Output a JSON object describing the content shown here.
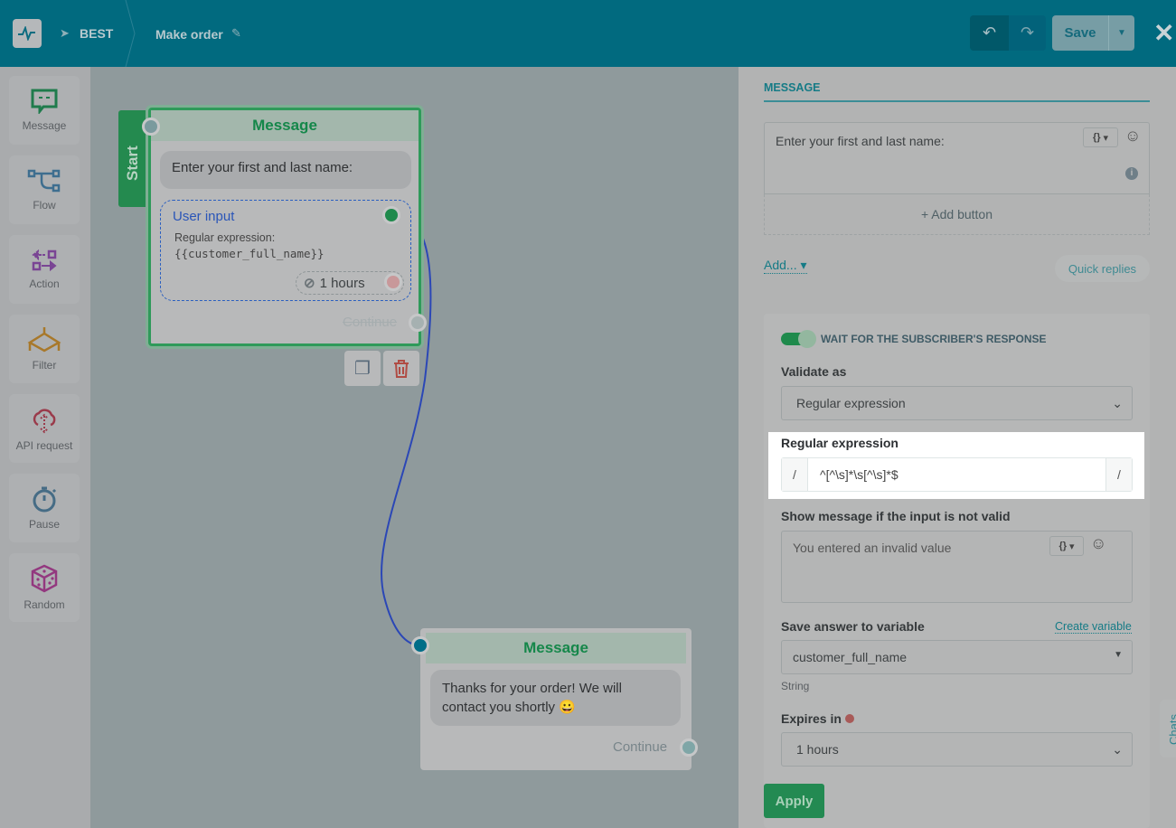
{
  "header": {
    "bot_name": "BEST",
    "flow_name": "Make order",
    "save_label": "Save"
  },
  "sidebar": {
    "items": [
      {
        "label": "Message",
        "icon": "message-icon"
      },
      {
        "label": "Flow",
        "icon": "flow-icon"
      },
      {
        "label": "Action",
        "icon": "action-icon"
      },
      {
        "label": "Filter",
        "icon": "filter-icon"
      },
      {
        "label": "API request",
        "icon": "cloud-icon"
      },
      {
        "label": "Pause",
        "icon": "stopwatch-icon"
      },
      {
        "label": "Random",
        "icon": "dice-icon"
      }
    ]
  },
  "canvas": {
    "start_label": "Start",
    "node1": {
      "title": "Message",
      "text": "Enter your first and last name:",
      "user_input_title": "User input",
      "validation": "Regular expression:",
      "variable": "{{customer_full_name}}",
      "timeout": "1 hours",
      "continue": "Continue"
    },
    "node2": {
      "title": "Message",
      "text": "Thanks for your order! We will contact you shortly 😀",
      "continue": "Continue"
    }
  },
  "panel": {
    "tab": "MESSAGE",
    "message_text": "Enter your first and last name:",
    "add_button": "+ Add button",
    "add_menu": "Add...",
    "quick_replies": "Quick replies",
    "wait_label": "WAIT FOR THE SUBSCRIBER'S RESPONSE",
    "wait_enabled": true,
    "validate_label": "Validate as",
    "validate_value": "Regular expression",
    "regex_label": "Regular expression",
    "regex_prefix": "/",
    "regex_value": "^[^\\s]*\\s[^\\s]*$",
    "regex_suffix": "/",
    "invalid_label": "Show message if the input is not valid",
    "invalid_value": "You entered an invalid value",
    "save_label": "Save answer to variable",
    "create_variable": "Create variable",
    "variable_value": "customer_full_name",
    "variable_type": "String",
    "expires_label": "Expires in",
    "expires_value": "1 hours",
    "apply": "Apply",
    "chats_tab": "Chats"
  }
}
